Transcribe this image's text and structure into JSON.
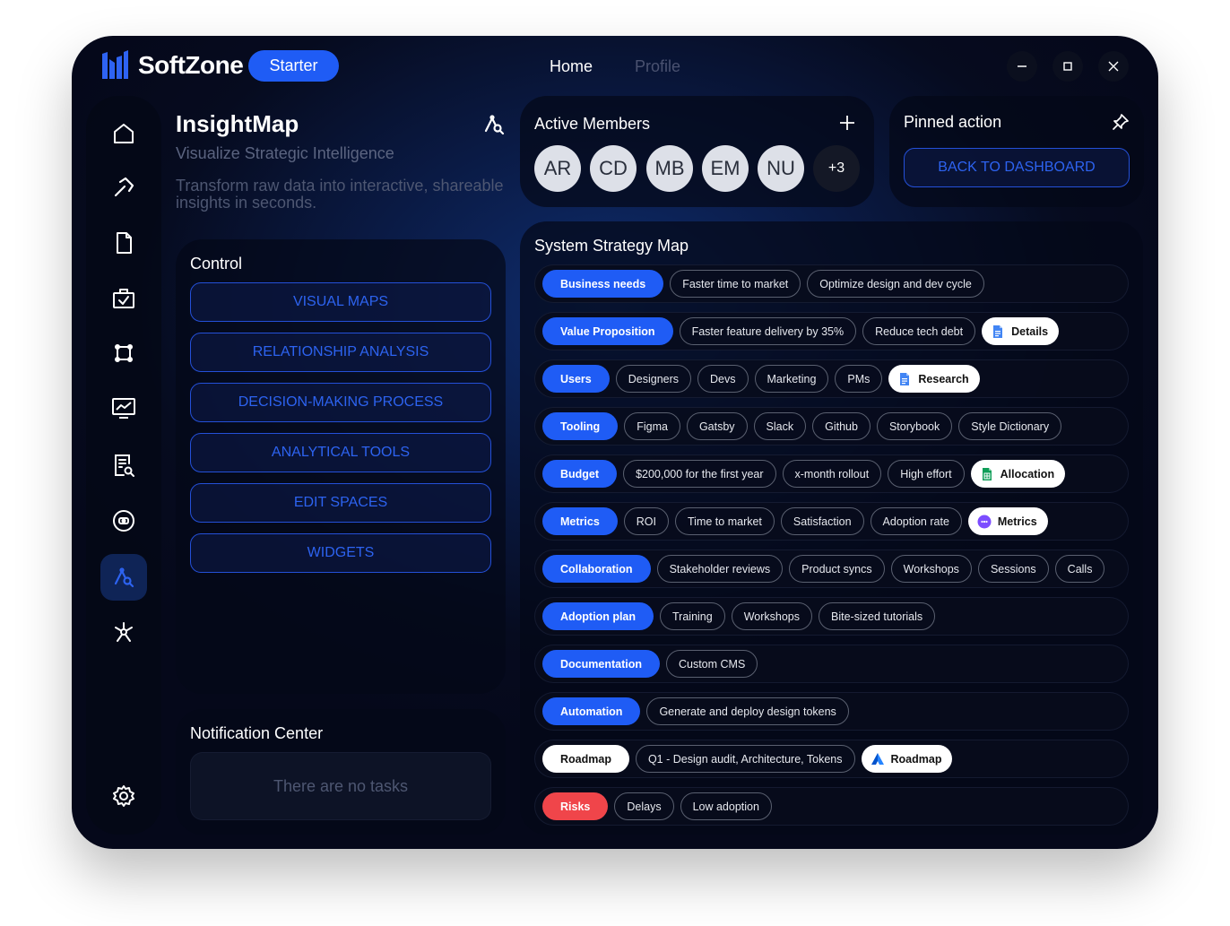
{
  "app": {
    "name": "SoftZone",
    "plan": "Starter"
  },
  "nav": {
    "home": "Home",
    "profile": "Profile"
  },
  "window_controls": [
    "minimize",
    "maximize",
    "close"
  ],
  "sidebar": {
    "icons": [
      "home-icon",
      "hammer-icon",
      "document-icon",
      "briefcase-check-icon",
      "frame-icon",
      "monitor-chart-icon",
      "report-search-icon",
      "shield-icon",
      "insight-map-icon",
      "network-icon",
      "settings-icon"
    ],
    "active": "insight-map-icon"
  },
  "insight": {
    "title": "InsightMap",
    "subtitle": "Visualize Strategic Intelligence",
    "description": "Transform raw data into interactive, shareable insights in seconds."
  },
  "control": {
    "title": "Control",
    "buttons": [
      "VISUAL MAPS",
      "RELATIONSHIP ANALYSIS",
      "DECISION-MAKING PROCESS",
      "ANALYTICAL TOOLS",
      "EDIT SPACES",
      "WIDGETS"
    ]
  },
  "notifications": {
    "title": "Notification Center",
    "empty": "There are no tasks"
  },
  "members": {
    "title": "Active Members",
    "avatars": [
      "AR",
      "CD",
      "MB",
      "EM",
      "NU"
    ],
    "more": "+3"
  },
  "pinned": {
    "title": "Pinned action",
    "button": "BACK TO DASHBOARD"
  },
  "strategy": {
    "title": "System Strategy Map",
    "rows": [
      {
        "category": "Business needs",
        "style": "blue",
        "tags": [
          "Faster time to market",
          "Optimize design and dev cycle"
        ],
        "link": null
      },
      {
        "category": "Value Proposition",
        "style": "blue",
        "tags": [
          "Faster feature delivery by 35%",
          "Reduce tech debt"
        ],
        "link": {
          "label": "Details",
          "icon": "google-docs-icon"
        }
      },
      {
        "category": "Users",
        "style": "blue",
        "tags": [
          "Designers",
          "Devs",
          "Marketing",
          "PMs"
        ],
        "link": {
          "label": "Research",
          "icon": "google-docs-icon"
        }
      },
      {
        "category": "Tooling",
        "style": "blue",
        "tags": [
          "Figma",
          "Gatsby",
          "Slack",
          "Github",
          "Storybook",
          "Style Dictionary"
        ],
        "link": null
      },
      {
        "category": "Budget",
        "style": "blue",
        "tags": [
          "$200,000 for the first year",
          "x-month rollout",
          "High effort"
        ],
        "link": {
          "label": "Allocation",
          "icon": "google-sheets-icon"
        }
      },
      {
        "category": "Metrics",
        "style": "blue",
        "tags": [
          "ROI",
          "Time to market",
          "Satisfaction",
          "Adoption rate"
        ],
        "link": {
          "label": "Metrics",
          "icon": "chat-app-icon"
        }
      },
      {
        "category": "Collaboration",
        "style": "blue",
        "tags": [
          "Stakeholder reviews",
          "Product syncs",
          "Workshops",
          "Sessions",
          "Calls"
        ],
        "link": null
      },
      {
        "category": "Adoption plan",
        "style": "blue",
        "tags": [
          "Training",
          "Workshops",
          "Bite-sized tutorials"
        ],
        "link": null
      },
      {
        "category": "Documentation",
        "style": "blue",
        "tags": [
          "Custom CMS"
        ],
        "link": null
      },
      {
        "category": "Automation",
        "style": "blue",
        "tags": [
          "Generate and deploy design tokens"
        ],
        "link": null
      },
      {
        "category": "Roadmap",
        "style": "white",
        "tags": [
          "Q1 - Design audit, Architecture, Tokens"
        ],
        "link": {
          "label": "Roadmap",
          "icon": "jira-icon"
        }
      },
      {
        "category": "Risks",
        "style": "red",
        "tags": [
          "Delays",
          "Low adoption"
        ],
        "link": null
      }
    ]
  },
  "colors": {
    "accent": "#1f5cf5",
    "risk": "#f0454a",
    "background": "#060b1f"
  }
}
